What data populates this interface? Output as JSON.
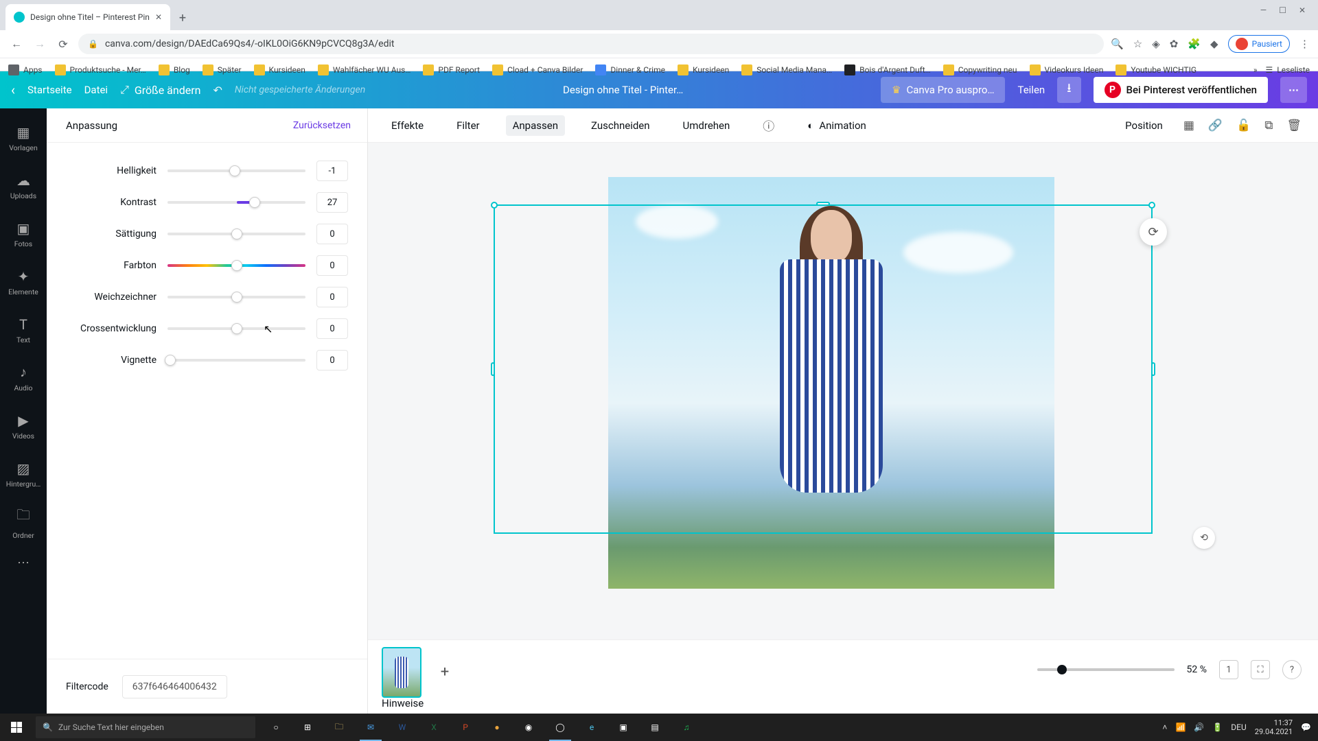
{
  "browser": {
    "tab_title": "Design ohne Titel – Pinterest Pin",
    "url": "canva.com/design/DAEdCa69Qs4/-oIKL0OiG6KN9pCVCQ8g3A/edit",
    "pause_label": "Pausiert"
  },
  "bookmarks": {
    "apps": "Apps",
    "items": [
      "Produktsuche - Mer…",
      "Blog",
      "Später",
      "Kursideen",
      "Wahlfächer WU Aus…",
      "PDF Report",
      "Cload + Canva Bilder",
      "Dinner & Crime",
      "Kursideen",
      "Social Media Mana…",
      "Bois d'Argent Duft…",
      "Copywriting neu",
      "Videokurs Ideen",
      "Youtube WICHTIG"
    ],
    "readlist": "Leseliste"
  },
  "header": {
    "home": "Startseite",
    "file": "Datei",
    "resize": "Größe ändern",
    "unsaved": "Nicht gespeicherte Änderungen",
    "doc_title": "Design ohne Titel - Pinter…",
    "trypro": "Canva Pro auspro…",
    "share": "Teilen",
    "pinterest": "Bei Pinterest veröffentlichen"
  },
  "rail": [
    {
      "icon": "▦",
      "label": "Vorlagen"
    },
    {
      "icon": "☁",
      "label": "Uploads"
    },
    {
      "icon": "▣",
      "label": "Fotos"
    },
    {
      "icon": "✦",
      "label": "Elemente"
    },
    {
      "icon": "T",
      "label": "Text"
    },
    {
      "icon": "♪",
      "label": "Audio"
    },
    {
      "icon": "▶",
      "label": "Videos"
    },
    {
      "icon": "▨",
      "label": "Hintergru…"
    },
    {
      "icon": "🗀",
      "label": "Ordner"
    }
  ],
  "panel": {
    "title": "Anpassung",
    "reset": "Zurücksetzen",
    "sliders": [
      {
        "label": "Helligkeit",
        "value": "-1",
        "pos": 49,
        "fill_from": 49,
        "fill_to": 50
      },
      {
        "label": "Kontrast",
        "value": "27",
        "pos": 63,
        "fill_from": 50,
        "fill_to": 63
      },
      {
        "label": "Sättigung",
        "value": "0",
        "pos": 50,
        "fill_from": 50,
        "fill_to": 50
      },
      {
        "label": "Farbton",
        "value": "0",
        "pos": 50,
        "hue": true
      },
      {
        "label": "Weichzeichner",
        "value": "0",
        "pos": 50,
        "fill_from": 50,
        "fill_to": 50
      },
      {
        "label": "Crossentwicklung",
        "value": "0",
        "pos": 50,
        "fill_from": 50,
        "fill_to": 50
      },
      {
        "label": "Vignette",
        "value": "0",
        "pos": 2,
        "fill_from": 0,
        "fill_to": 2
      }
    ],
    "filtercode_label": "Filtercode",
    "filtercode_value": "637f646464006432"
  },
  "ctx": {
    "items": [
      "Effekte",
      "Filter",
      "Anpassen",
      "Zuschneiden",
      "Umdrehen"
    ],
    "animation": "Animation",
    "position": "Position",
    "active_index": 2
  },
  "footer": {
    "hinweise": "Hinweise",
    "zoom_pct": "52 %",
    "page_badge": "1"
  },
  "taskbar": {
    "search_placeholder": "Zur Suche Text hier eingeben",
    "time": "11:37",
    "date": "29.04.2021",
    "lang": "DEU"
  }
}
